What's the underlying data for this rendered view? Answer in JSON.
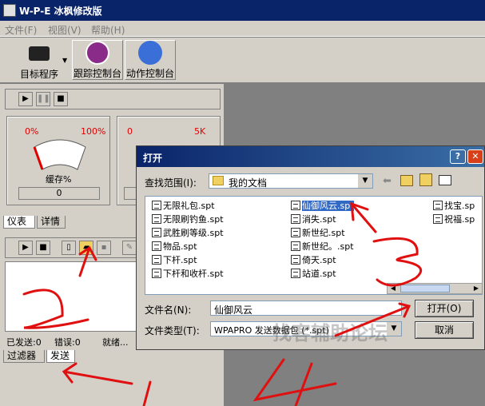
{
  "app": {
    "title": "W-P-E 冰枫修改版"
  },
  "menu": {
    "items": [
      "文件(F)",
      "视图(V)",
      "帮助(H)"
    ]
  },
  "toolbar": {
    "target_label": "目标程序",
    "trace_label": "跟踪控制台",
    "action_label": "动作控制台"
  },
  "gauges": [
    {
      "min": "0%",
      "max": "100%",
      "caption": "缓存%",
      "value": "0"
    },
    {
      "min": "0",
      "max": "5K",
      "caption": "",
      "value": ""
    }
  ],
  "tabs_top": [
    "仪表",
    "详情"
  ],
  "status": {
    "sent": "已发送:0",
    "errors": "错误:0",
    "state": "就绪..."
  },
  "tabs_bottom": [
    "过滤器",
    "发送"
  ],
  "dialog": {
    "title": "打开",
    "lookin_label": "查找范围(I):",
    "lookin_value": "我的文档",
    "files_col1": [
      "无限礼包.spt",
      "无限刷钓鱼.spt",
      "武胜刷等级.spt",
      "物品.spt",
      "下杆.spt",
      "下杆和收杆.spt"
    ],
    "files_col2": [
      "仙御风云.spt",
      "消失.spt",
      "新世纪.spt",
      "新世纪。.spt",
      "倚天.spt",
      "站道.spt"
    ],
    "files_col3": [
      "找宝.sp",
      "祝福.sp"
    ],
    "filename_label": "文件名(N):",
    "filename_value": "仙御风云",
    "filetype_label": "文件类型(T):",
    "filetype_value": "WPAPRO 发送数据包  (*.spt)",
    "open_button": "打开(O)",
    "cancel_button": "取消"
  },
  "watermark": "找客辅助论坛",
  "annotations": [
    "1",
    "2",
    "3",
    "4"
  ],
  "colors": {
    "titlebar": "#0a246a",
    "selection": "#316ac5",
    "annotation": "#e01010"
  }
}
